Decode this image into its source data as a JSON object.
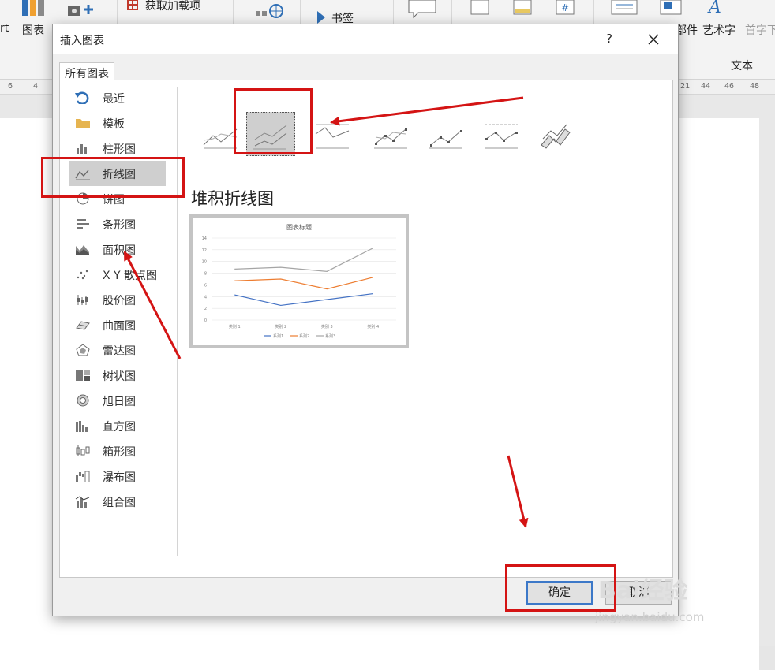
{
  "ribbon": {
    "partial_left": "rt",
    "chart_button": "图表",
    "get_addins": "获取加载项",
    "bookmark": "书签",
    "parts_partial": "部件",
    "wordart": "艺术字",
    "dropcap_partial": "首字下",
    "group_text": "文本"
  },
  "ruler": {
    "left_marks": [
      "6",
      "4"
    ],
    "right_marks": [
      "21",
      "44",
      "46",
      "48"
    ]
  },
  "dialog": {
    "title": "插入图表",
    "help": "?",
    "tab_all_charts": "所有图表",
    "categories": [
      {
        "label": "最近",
        "icon": "recent-icon"
      },
      {
        "label": "模板",
        "icon": "folder-icon"
      },
      {
        "label": "柱形图",
        "icon": "column-chart-icon"
      },
      {
        "label": "折线图",
        "icon": "line-chart-icon",
        "selected": true
      },
      {
        "label": "饼图",
        "icon": "pie-chart-icon"
      },
      {
        "label": "条形图",
        "icon": "bar-chart-icon"
      },
      {
        "label": "面积图",
        "icon": "area-chart-icon"
      },
      {
        "label": "X Y 散点图",
        "icon": "scatter-chart-icon"
      },
      {
        "label": "股价图",
        "icon": "stock-chart-icon"
      },
      {
        "label": "曲面图",
        "icon": "surface-chart-icon"
      },
      {
        "label": "雷达图",
        "icon": "radar-chart-icon"
      },
      {
        "label": "树状图",
        "icon": "treemap-chart-icon"
      },
      {
        "label": "旭日图",
        "icon": "sunburst-chart-icon"
      },
      {
        "label": "直方图",
        "icon": "histogram-chart-icon"
      },
      {
        "label": "箱形图",
        "icon": "box-chart-icon"
      },
      {
        "label": "瀑布图",
        "icon": "waterfall-chart-icon"
      },
      {
        "label": "组合图",
        "icon": "combo-chart-icon"
      }
    ],
    "subtypes": [
      {
        "name": "line",
        "selected": false
      },
      {
        "name": "stacked-line",
        "selected": true
      },
      {
        "name": "percent-stacked-line",
        "selected": false
      },
      {
        "name": "line-with-markers",
        "selected": false
      },
      {
        "name": "stacked-line-with-markers",
        "selected": false
      },
      {
        "name": "percent-stacked-line-with-markers",
        "selected": false
      },
      {
        "name": "3d-line",
        "selected": false
      }
    ],
    "selected_subtype_name": "堆积折线图",
    "ok_label": "确定",
    "cancel_label": "取消"
  },
  "preview_chart": {
    "title": "图表标题",
    "colors": {
      "系列1": "#4472c4",
      "系列2": "#ed7d31",
      "系列3": "#a5a5a5"
    }
  },
  "chart_data": {
    "type": "line",
    "title": "图表标题",
    "categories": [
      "类别 1",
      "类别 2",
      "类别 3",
      "类别 4"
    ],
    "series": [
      {
        "name": "系列1",
        "values": [
          4.3,
          2.5,
          3.5,
          4.5
        ]
      },
      {
        "name": "系列2",
        "values": [
          6.7,
          7.0,
          5.3,
          7.3
        ]
      },
      {
        "name": "系列3",
        "values": [
          8.7,
          9.0,
          8.3,
          12.3
        ]
      }
    ],
    "yticks": [
      0,
      2,
      4,
      6,
      8,
      10,
      12,
      14
    ],
    "ylim": [
      0,
      14
    ],
    "grid": true,
    "legend": "bottom"
  },
  "watermark": {
    "logo": "Bai经验",
    "url": "jingyan.baidu.com"
  }
}
